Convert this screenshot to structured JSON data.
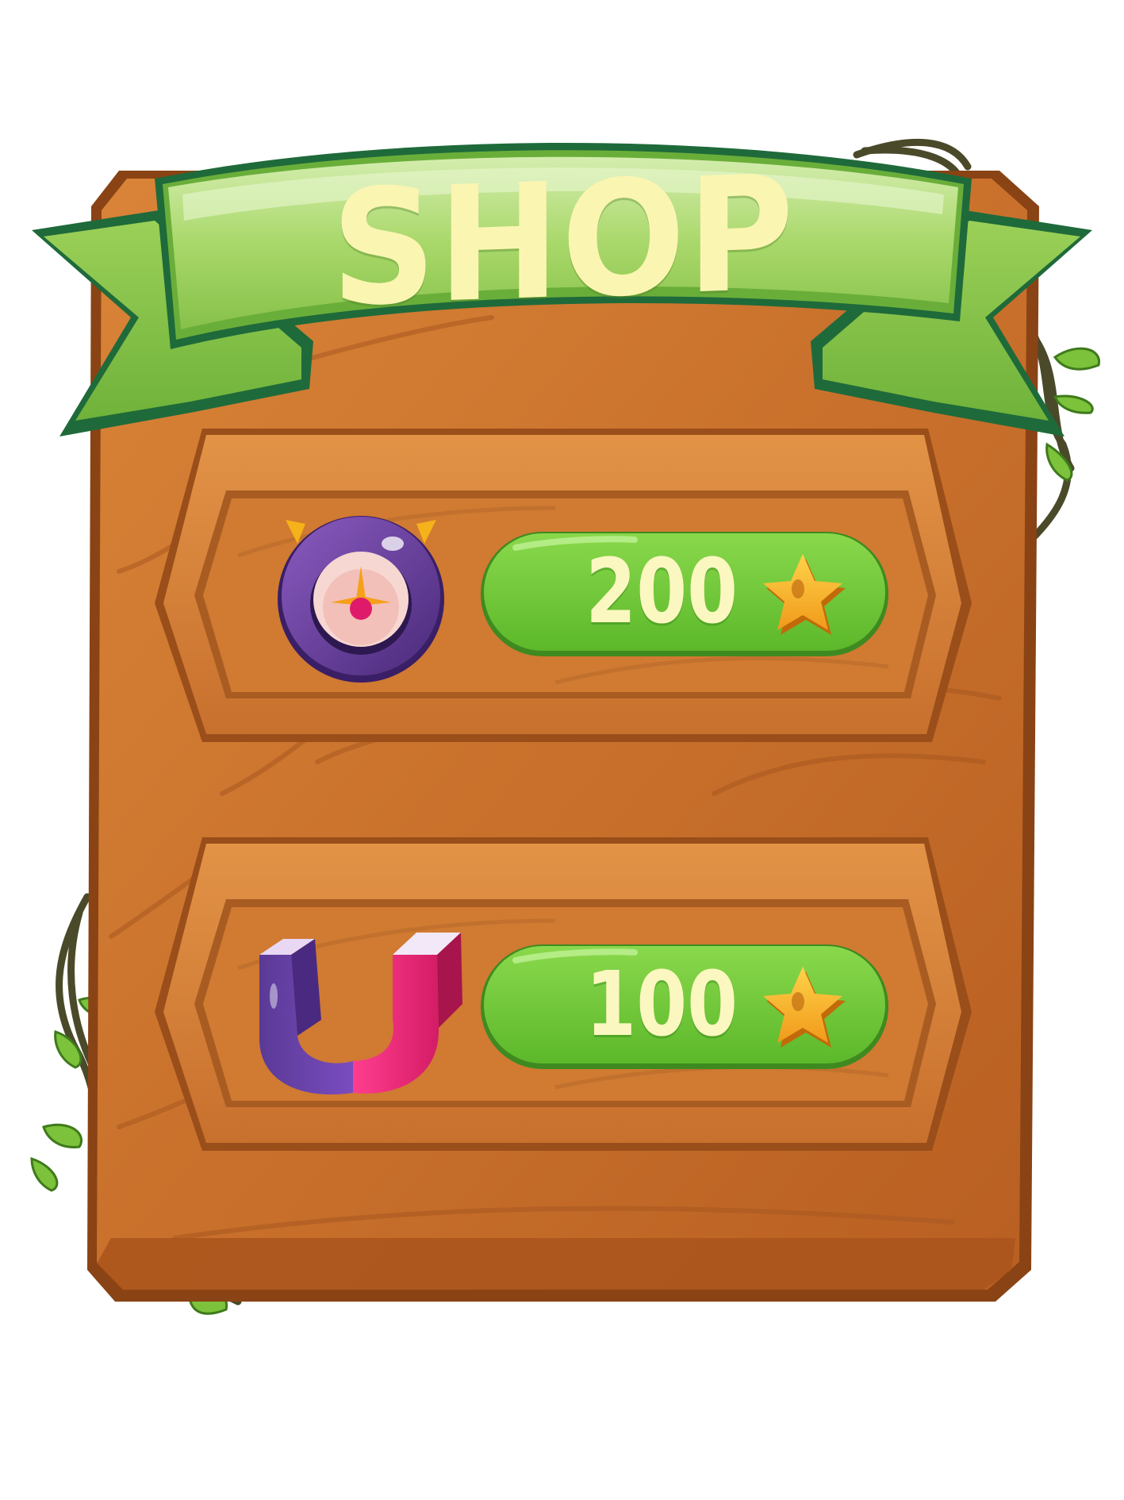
{
  "shop": {
    "title": "SHOP",
    "items": [
      {
        "name": "clock-powerup",
        "icon": "clock-icon",
        "price": "200",
        "currency_icon": "star-icon"
      },
      {
        "name": "magnet-powerup",
        "icon": "magnet-icon",
        "price": "100",
        "currency_icon": "star-icon"
      }
    ]
  },
  "colors": {
    "wood": "#c8702e",
    "ribbon": "#8cc84a",
    "button": "#6cc836",
    "star": "#f5a623",
    "text": "#fbf5b2"
  }
}
